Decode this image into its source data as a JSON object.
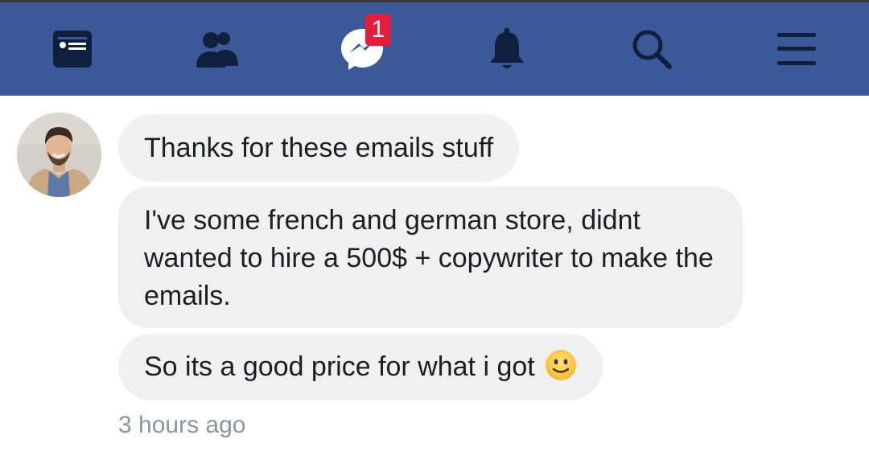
{
  "navbar": {
    "background": "#3b5998",
    "items": [
      {
        "icon": "news-feed-icon"
      },
      {
        "icon": "friends-icon"
      },
      {
        "icon": "messenger-icon",
        "badge": "1"
      },
      {
        "icon": "bell-icon"
      },
      {
        "icon": "search-icon"
      },
      {
        "icon": "menu-icon"
      }
    ]
  },
  "conversation": {
    "messages": [
      {
        "text": "Thanks for these emails stuff"
      },
      {
        "text": "I've some french and german store, didnt wanted to hire a 500$ + copywriter to make the emails."
      },
      {
        "text": "So its a good price for what i got",
        "emoji": "slightly-smiling-face"
      }
    ],
    "timestamp": "3 hours ago"
  }
}
